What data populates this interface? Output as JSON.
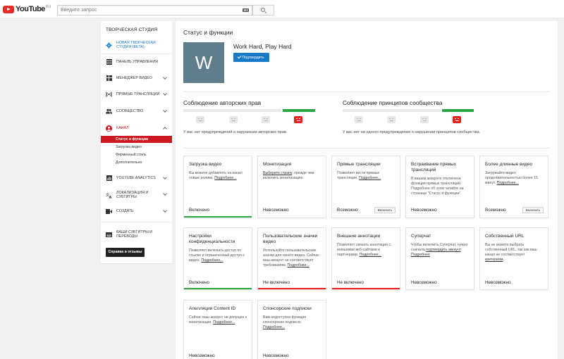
{
  "masthead": {
    "logo_text": "YouTube",
    "logo_region": "RU",
    "search_placeholder": "Введите запрос"
  },
  "sidebar": {
    "title": "ТВОРЧЕСКАЯ СТУДИЯ",
    "items": [
      {
        "label": "НОВАЯ ТВОРЧЕСКАЯ СТУДИЯ (BETA)",
        "icon": "gear-icon",
        "color": "#167ac6"
      },
      {
        "label": "ПАНЕЛЬ УПРАВЛЕНИЯ",
        "icon": "dashboard-icon"
      },
      {
        "label": "МЕНЕДЖЕР ВИДЕО",
        "icon": "video-manager-icon"
      },
      {
        "label": "ПРЯМЫЕ ТРАНСЛЯЦИИ",
        "icon": "live-icon"
      },
      {
        "label": "СООБЩЕСТВО",
        "icon": "community-icon"
      },
      {
        "label": "КАНАЛ",
        "icon": "channel-icon",
        "color": "#cc181e"
      },
      {
        "label": "YOUTUBE ANALYTICS",
        "icon": "analytics-icon"
      },
      {
        "label": "ЛОКАЛИЗАЦИЯ И СУБТИТРЫ",
        "icon": "translate-icon"
      },
      {
        "label": "СОЗДАТЬ",
        "icon": "create-icon"
      },
      {
        "label": "ВАШИ СУБТИТРЫ И ПЕРЕВОДЫ",
        "icon": "subtitles-icon"
      }
    ],
    "channel_sub": [
      "Статус и функции",
      "Загрузка видео",
      "Фирменный стиль",
      "Дополнительно"
    ],
    "help_button": "Справка и отзывы"
  },
  "main": {
    "page_title": "Статус и функции",
    "avatar_letter": "W",
    "channel_name": "Work Hard, Play Hard",
    "verify_button": "Подтвердить",
    "copyright": {
      "title": "Соблюдение авторских прав",
      "message": "У вас нет предупреждений о нарушении авторских прав."
    },
    "community": {
      "title": "Соблюдение принципов сообщества",
      "message": "У вас нет ни одного предупреждения о нарушении принципов сообщества."
    },
    "strike_level": 0,
    "cards": [
      {
        "title": "Загрузка видео",
        "desc": "Вы можете добавлять на канал новые ролики. ",
        "link": "Подробнее...",
        "status": "Включено",
        "state": "on"
      },
      {
        "title": "Монетизация",
        "desc_link_first": "Выберите страну",
        "desc": ", прежде чем включить монетизацию.",
        "status": "Невозможно",
        "state": "none"
      },
      {
        "title": "Прямые трансляции",
        "desc": "Позволяет вести прямые трансляции. ",
        "link": "Подробнее...",
        "status": "Возможно",
        "button": "Включить",
        "state": "none"
      },
      {
        "title": "Встраивание прямых трансляций",
        "desc": "В вашем аккаунте отключена функция прямых трансляций. Подробнее об этом читайте на странице \"Статус и функции\".",
        "status": "Невозможно",
        "state": "none"
      },
      {
        "title": "Более длинные видео",
        "desc": "Загружайте видео продолжительностью более 15 минут. ",
        "link": "Подробнее...",
        "status": "Возможно",
        "button": "Включить",
        "state": "none"
      },
      {
        "title": "Настройки конфиденциальности",
        "desc": "Позволяет включать доступ по ссылке и ограниченный доступ к видео. ",
        "link": "Подробнее...",
        "status": "Включено",
        "state": "on"
      },
      {
        "title": "Пользовательские значки видео",
        "desc": "Используйте пользовательские значки для своего видео. Сейчас ваш аккаунт не соответствует требованиям. ",
        "link": "Подробнее...",
        "status": "Не включено",
        "state": "off"
      },
      {
        "title": "Внешние аннотации",
        "desc": "Позволяет связать аннотации с внешними веб-сайтами и партнерами. ",
        "link": "Подробнее...",
        "status": "Не включено",
        "state": "off"
      },
      {
        "title": "Суперчат",
        "desc": "Чтобы включить Суперчат, нужно сначала ",
        "desc_link_mid": "подтвердить аккаунт",
        "desc_after": ". ",
        "link": "Подробнее",
        "status": "Невозможно",
        "state": "none"
      },
      {
        "title": "Собственный URL",
        "desc": "Вы не можете выбрать собственный URL, так как ваш канал не соответствует ",
        "link": "критериям",
        "desc_after": ".",
        "status": "Невозможно",
        "state": "none"
      },
      {
        "title": "Апелляции Content ID",
        "desc": "Сейчас ваш аккаунт не допущен к монетизации. ",
        "link": "Подробнее...",
        "status": "Невозможно",
        "state": "none"
      },
      {
        "title": "Спонсорские подписки",
        "desc": "Вам недоступна функция спонсорских подписок. ",
        "link": "Подробнее...",
        "status": "Невозможно",
        "state": "none"
      }
    ]
  },
  "colors": {
    "brand_red": "#cc181e",
    "accent_blue": "#167ac6",
    "status_green": "#2ba640",
    "status_red": "#e62117"
  }
}
